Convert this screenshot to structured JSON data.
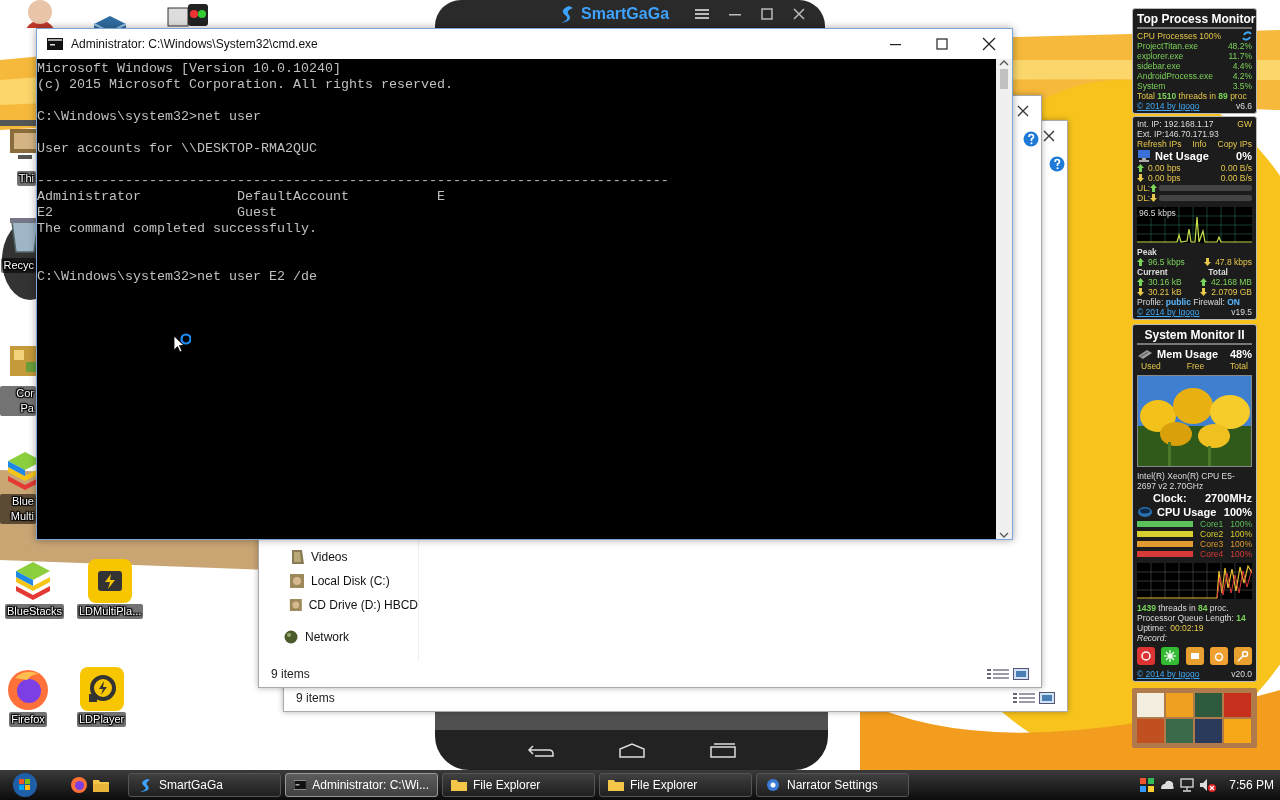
{
  "desktop_icons": [
    {
      "label": "Thi",
      "kind": "computer"
    },
    {
      "label": "Recyc",
      "kind": "recycle"
    },
    {
      "label": "Cor Pa",
      "kind": "panel"
    },
    {
      "label": "Blue Multi",
      "kind": "bluestacks"
    },
    {
      "label": "BlueStacks",
      "kind": "bluestacks"
    },
    {
      "label": "LDMultiPla...",
      "kind": "ldmulti"
    },
    {
      "label": "Firefox",
      "kind": "firefox"
    },
    {
      "label": "LDPlayer",
      "kind": "ldplayer"
    }
  ],
  "emulator": {
    "title": "SmartGaGa"
  },
  "explorer_windows": [
    {
      "nav_items": [
        {
          "label": "Videos",
          "kind": "folder"
        },
        {
          "label": "Local Disk (C:)",
          "kind": "drive"
        },
        {
          "label": "CD Drive (D:) HBCD",
          "kind": "drive"
        },
        {
          "label": "Network",
          "kind": "network"
        }
      ],
      "status": "9 items"
    },
    {
      "status": "9 items"
    }
  ],
  "cmd_window": {
    "title": "Administrator: C:\\Windows\\System32\\cmd.exe",
    "console": [
      {
        "kind": "top",
        "lines": [
          "Microsoft Windows [Version 10.0.10240]",
          "(c) 2015 Microsoft Corporation. All rights reserved."
        ]
      },
      {
        "kind": "spaced",
        "lines": [
          "C:\\Windows\\system32>net user"
        ]
      },
      {
        "kind": "spaced",
        "lines": [
          "User accounts for \\\\DESKTOP-RMA2QUC"
        ]
      },
      {
        "kind": "spaced",
        "lines": [
          "-------------------------------------------------------------------------------",
          "Administrator            DefaultAccount           E",
          "E2                       Guest",
          "The command completed successfully."
        ]
      },
      {
        "kind": "widespaced",
        "lines": [
          "C:\\Windows\\system32>net user E2 /de"
        ]
      }
    ]
  },
  "top_process_monitor": {
    "title": "Top Process Monitor",
    "header": "CPU Processes 100%",
    "processes": [
      {
        "name": "ProjectTitan.exe",
        "value": "48.2%"
      },
      {
        "name": "explorer.exe",
        "value": "11.7%"
      },
      {
        "name": "sidebar.exe",
        "value": "4.4%"
      },
      {
        "name": "AndroidProcess.exe",
        "value": "4.2%"
      },
      {
        "name": "System",
        "value": "3.5%"
      }
    ],
    "total": "Total **1510** threads in **89** proc",
    "footer_link": "© 2014 by Igogo",
    "version": "v6.6"
  },
  "network_monitor": {
    "int_ip": "Int. IP: 192.168.1.17",
    "gateway": "GW",
    "ext_ip": "Ext. IP:146.70.171.93",
    "links": [
      "Refresh IPs",
      "Info",
      "Copy IPs"
    ],
    "title": "Net Usage",
    "usage": "0%",
    "rates": [
      {
        "bps": "0.00 bps",
        "bytes": "0.00 B/s"
      },
      {
        "bps": "0.00 bps",
        "bytes": "0.00 B/s"
      }
    ],
    "bars": [
      {
        "label": "UL:",
        "level": 0
      },
      {
        "label": "DL:",
        "level": 0
      }
    ],
    "graph_label": "96.5 kbps",
    "peak_label": "Peak",
    "peak": [
      "96.5 kbps",
      "47.8 kbps"
    ],
    "current_label": "Current",
    "total_label": "Total",
    "totals": [
      {
        "current": "30.16 kB",
        "total": "42.168 MB"
      },
      {
        "current": "30.21 kB",
        "total": "2.0709 GB"
      }
    ],
    "profile": "Profile: **public** Firewall: **ON**",
    "footer_link": "© 2014 by Igogo",
    "version": "v19.5"
  },
  "system_monitor": {
    "title": "System Monitor II",
    "mem_title": "Mem Usage",
    "mem_usage": "48%",
    "mem_columns": [
      "Used",
      "Free",
      "Total"
    ],
    "cpu_name": "Intel(R) Xeon(R) CPU E5-2697 v2 2.70GHz",
    "clock_label": "Clock:",
    "clock": "2700MHz",
    "cpu_title": "CPU Usage",
    "cpu_usage": "100%",
    "cores": [
      {
        "name": "Core1",
        "value": "100%",
        "level": 1,
        "color": "#5cc35c"
      },
      {
        "name": "Core2",
        "value": "100%",
        "level": 1,
        "color": "#d8d030"
      },
      {
        "name": "Core3",
        "value": "100%",
        "level": 1,
        "color": "#e09a30"
      },
      {
        "name": "Core4",
        "value": "100%",
        "level": 1,
        "color": "#d83a3a"
      }
    ],
    "threads": "**1439** threads in **84** proc.",
    "queue": "Processor Queue Length: **14**",
    "uptime_label": "Uptime:",
    "uptime": "00:02:19",
    "record_label": "Record:",
    "footer_link": "© 2014 by Igogo",
    "version": "v20.0"
  },
  "taskbar": {
    "tasks": [
      {
        "label": "SmartGaGa",
        "kind": "emulator",
        "selected": false
      },
      {
        "label": "Administrator: C:\\Wi...",
        "kind": "console",
        "selected": true
      },
      {
        "label": "File Explorer",
        "kind": "folder",
        "selected": false
      },
      {
        "label": "File Explorer",
        "kind": "folder",
        "selected": false
      },
      {
        "label": "Narrator Settings",
        "kind": "settings",
        "selected": false
      }
    ],
    "clock": "7:56 PM"
  }
}
